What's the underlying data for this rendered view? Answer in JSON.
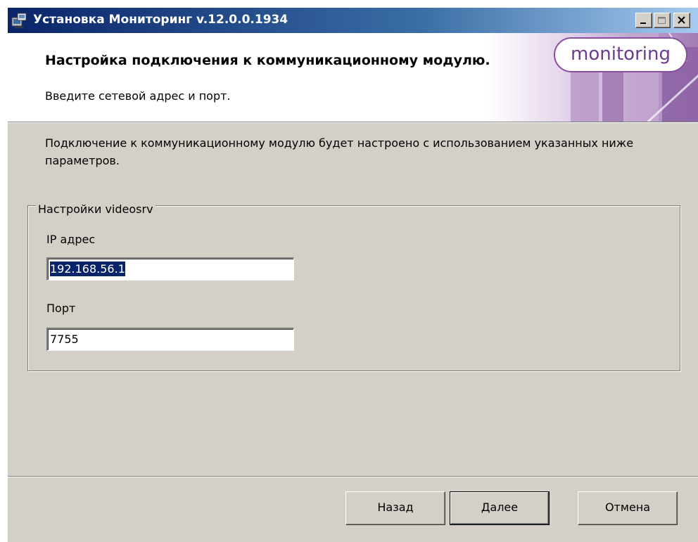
{
  "window": {
    "title": "Установка Мониторинг v.12.0.0.1934",
    "controls": {
      "minimize": "minimize-icon",
      "maximize": "maximize-icon",
      "close": "close-icon"
    }
  },
  "header": {
    "title": "Настройка подключения к коммуникационному модулю.",
    "subtitle": "Введите сетевой адрес и порт.",
    "logo_text": "monitoring"
  },
  "body": {
    "description": "Подключение к коммуникационному модулю будет настроено с использованием указанных ниже параметров.",
    "group": {
      "legend": "Настройки videosrv",
      "ip_label": "IP адрес",
      "ip_value": "192.168.56.1",
      "port_label": "Порт",
      "port_value": "7755"
    }
  },
  "buttons": {
    "back": "Назад",
    "next": "Далее",
    "cancel": "Отмена"
  },
  "colors": {
    "face": "#d4d0c8",
    "titlebar_start": "#0a246a",
    "titlebar_end": "#a6caf0",
    "selection": "#0a246a",
    "logo_accent": "#8a4ea0"
  }
}
